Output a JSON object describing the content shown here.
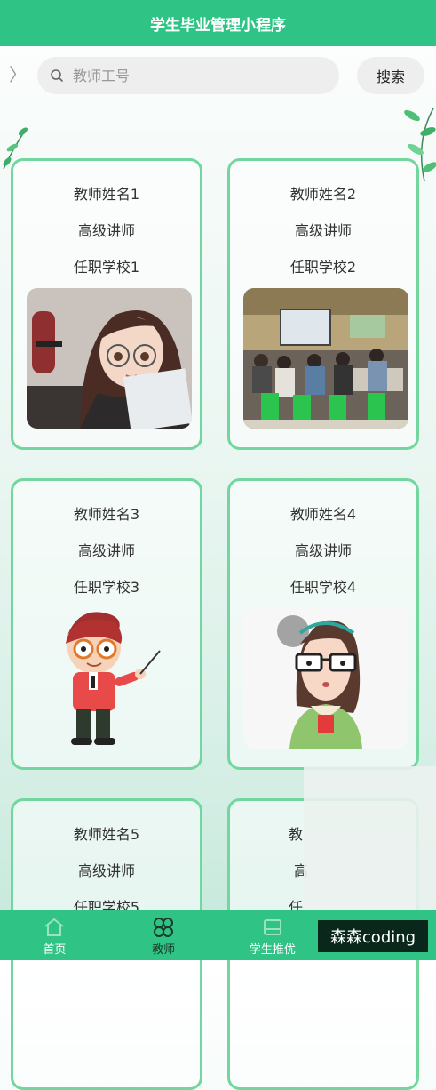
{
  "header": {
    "title": "学生毕业管理小程序"
  },
  "search": {
    "placeholder": "教师工号",
    "button_label": "搜索"
  },
  "teachers": [
    {
      "name": "教师姓名1",
      "title": "高级讲师",
      "school": "任职学校1",
      "photo": "girl-with-glasses-cartoon"
    },
    {
      "name": "教师姓名2",
      "title": "高级讲师",
      "school": "任职学校2",
      "photo": "classroom-photo"
    },
    {
      "name": "教师姓名3",
      "title": "高级讲师",
      "school": "任职学校3",
      "photo": "teacher-with-pointer-cartoon"
    },
    {
      "name": "教师姓名4",
      "title": "高级讲师",
      "school": "任职学校4",
      "photo": "teacher-woman-glasses-cartoon"
    },
    {
      "name": "教师姓名5",
      "title": "高级讲师",
      "school": "任职学校5",
      "photo": ""
    },
    {
      "name": "教",
      "title": "高",
      "school": "任",
      "photo": ""
    }
  ],
  "tabbar": [
    {
      "label": "首页",
      "icon": "home-icon"
    },
    {
      "label": "教师",
      "icon": "grid-icon",
      "active": true
    },
    {
      "label": "学生推优",
      "icon": "tray-icon"
    },
    {
      "label": "",
      "icon": ""
    }
  ],
  "watermark": "森森coding",
  "colors": {
    "primary": "#2fc486",
    "card_border": "#72d69e"
  }
}
